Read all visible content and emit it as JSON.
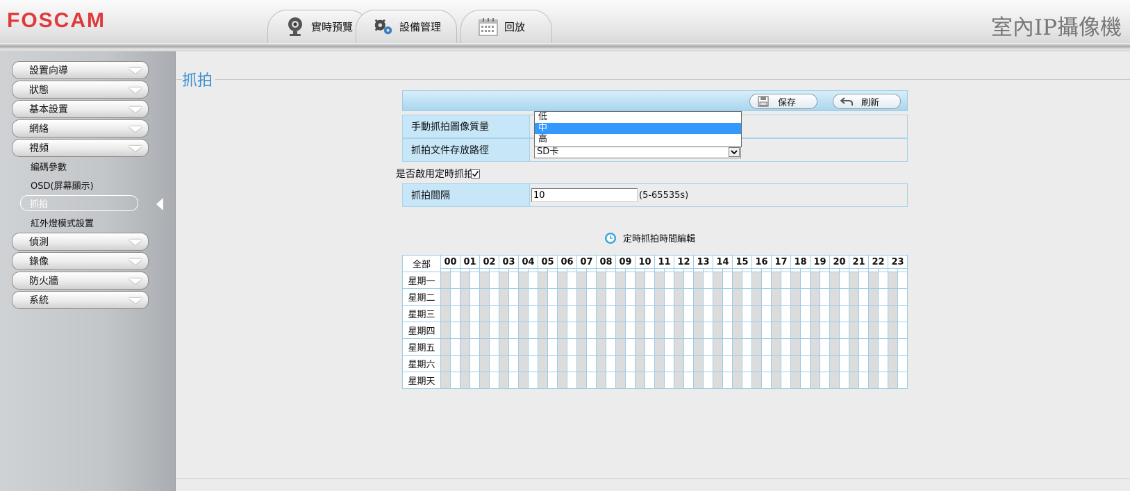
{
  "header": {
    "logo": "FOSCAM",
    "title": "室內IP攝像機",
    "tabs": [
      {
        "label": "實時預覽",
        "icon": "webcam-icon"
      },
      {
        "label": "設備管理",
        "icon": "gears-icon"
      },
      {
        "label": "回放",
        "icon": "calendar-icon"
      }
    ]
  },
  "sidebar": {
    "menu": [
      "設置向導",
      "狀態",
      "基本設置",
      "網絡",
      "視頻"
    ],
    "video_sub": [
      "編碼參數",
      "OSD(屏幕顯示)",
      "抓拍",
      "紅外燈模式設置"
    ],
    "menu_after": [
      "偵測",
      "錄像",
      "防火牆",
      "系統"
    ]
  },
  "page": {
    "title": "抓拍",
    "save_label": "保存",
    "refresh_label": "刷新",
    "quality_label": "手動抓拍圖像質量",
    "path_label": "抓拍文件存放路徑",
    "path_value": "SD卡",
    "quality_options": [
      "低",
      "中",
      "高"
    ],
    "quality_selected": "中",
    "enable_label": "是否啟用定時抓拍",
    "enable_checked": true,
    "interval_label": "抓拍間隔",
    "interval_value": "10",
    "interval_hint": "(5-65535s)",
    "schedule_title": "定時抓拍時間編輯",
    "schedule_all": "全部",
    "hours": [
      "00",
      "01",
      "02",
      "03",
      "04",
      "05",
      "06",
      "07",
      "08",
      "09",
      "10",
      "11",
      "12",
      "13",
      "14",
      "15",
      "16",
      "17",
      "18",
      "19",
      "20",
      "21",
      "22",
      "23"
    ],
    "days": [
      "星期一",
      "星期二",
      "星期三",
      "星期四",
      "星期五",
      "星期六",
      "星期天"
    ]
  }
}
